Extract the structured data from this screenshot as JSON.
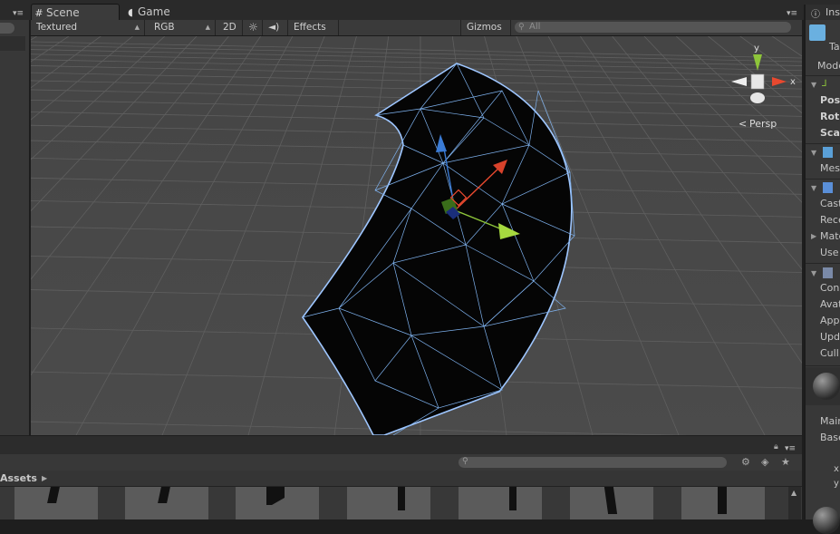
{
  "tabs": {
    "scene_label": "Scene",
    "game_label": "Game",
    "scene_icon": "grid-icon",
    "game_icon": "pacman-icon"
  },
  "toolbar": {
    "shading_mode": "Textured",
    "render_mode": "RGB",
    "mode_2d": "2D",
    "effects_label": "Effects",
    "gizmos_label": "Gizmos",
    "search_placeholder": "All"
  },
  "scene": {
    "persp_label": "Persp",
    "axis_x": "x",
    "axis_y": "y"
  },
  "inspector": {
    "tab_label": "Ins",
    "object_name_fragment": "Ta",
    "model_fragment": "Mode",
    "transform_rows": [
      "Pos",
      "Rot",
      "Sca"
    ],
    "mesh_fragment": "Mes",
    "renderer_rows": [
      "Cast",
      "Rece",
      "Mate",
      "Use "
    ],
    "animator_rows": [
      "Con",
      "Avat",
      "App",
      "Upd",
      "Cull"
    ],
    "material_rows": [
      "Main",
      "Base"
    ],
    "tiling_axes": [
      "x",
      "y"
    ]
  },
  "project": {
    "breadcrumb": "Assets"
  },
  "colors": {
    "axis_x": "#e8492f",
    "axis_y": "#8ec53a",
    "axis_z": "#3a7bd5",
    "wire": "#9ec6ff",
    "scene_bg": "#4a4a4a"
  }
}
